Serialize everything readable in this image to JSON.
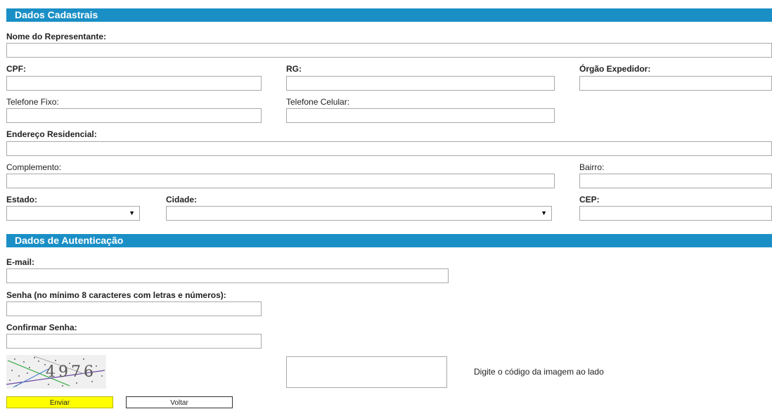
{
  "section1": {
    "title": "Dados Cadastrais"
  },
  "fields": {
    "nome": "Nome do Representante:",
    "cpf": "CPF:",
    "rg": "RG:",
    "orgao": "Órgão Expedidor:",
    "telefone_fixo": "Telefone Fixo:",
    "telefone_celular": "Telefone Celular:",
    "endereco": "Endereço Residencial:",
    "complemento": "Complemento:",
    "bairro": "Bairro:",
    "estado": "Estado:",
    "cidade": "Cidade:",
    "cep": "CEP:"
  },
  "section2": {
    "title": "Dados de Autenticação"
  },
  "auth": {
    "email": "E-mail:",
    "senha": "Senha (no mínimo 8 caracteres com letras e números):",
    "confirmar": "Confirmar Senha:"
  },
  "captcha": {
    "code": "4976",
    "instruction": "Digite o código da imagem ao lado"
  },
  "buttons": {
    "enviar": "Enviar",
    "voltar": "Voltar"
  },
  "colors": {
    "section_bar": "#1a8fc6",
    "enviar_bg": "#ffff00"
  },
  "icons": {
    "dropdown": "dropdown-arrow-icon"
  }
}
